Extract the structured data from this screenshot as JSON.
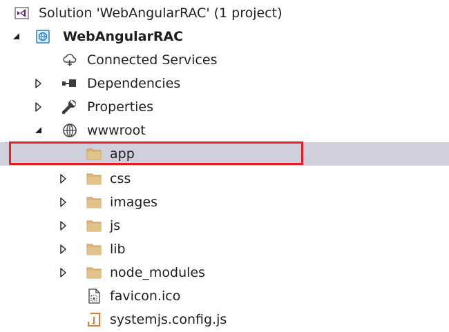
{
  "solution_explorer": {
    "colors": {
      "selection_background": "#cfd0dc",
      "highlight_border": "#e11f26",
      "folder": "#dcb67a",
      "project_icon": "#1e7fd6",
      "js_file_icon": "#e8772e"
    },
    "nodes": [
      {
        "label": "Solution 'WebAngularRAC' (1 project)",
        "icon": "visual-studio-solution-icon",
        "expander": "none",
        "bold": false
      },
      {
        "label": "WebAngularRAC",
        "icon": "web-project-icon",
        "expander": "expanded",
        "bold": true
      },
      {
        "label": "Connected Services",
        "icon": "connected-services-cloud-icon",
        "expander": "none",
        "bold": false
      },
      {
        "label": "Dependencies",
        "icon": "dependencies-icon",
        "expander": "collapsed",
        "bold": false
      },
      {
        "label": "Properties",
        "icon": "wrench-icon",
        "expander": "collapsed",
        "bold": false
      },
      {
        "label": "wwwroot",
        "icon": "globe-icon",
        "expander": "expanded",
        "bold": false
      },
      {
        "label": "app",
        "icon": "folder-icon",
        "expander": "none",
        "bold": false,
        "selected": true
      },
      {
        "label": "css",
        "icon": "folder-icon",
        "expander": "collapsed",
        "bold": false
      },
      {
        "label": "images",
        "icon": "folder-icon",
        "expander": "collapsed",
        "bold": false
      },
      {
        "label": "js",
        "icon": "folder-icon",
        "expander": "collapsed",
        "bold": false
      },
      {
        "label": "lib",
        "icon": "folder-icon",
        "expander": "collapsed",
        "bold": false
      },
      {
        "label": "node_modules",
        "icon": "folder-icon",
        "expander": "collapsed",
        "bold": false
      },
      {
        "label": "favicon.ico",
        "icon": "icon-file-icon",
        "expander": "none",
        "bold": false
      },
      {
        "label": "systemjs.config.js",
        "icon": "javascript-file-icon",
        "expander": "none",
        "bold": false
      }
    ]
  }
}
